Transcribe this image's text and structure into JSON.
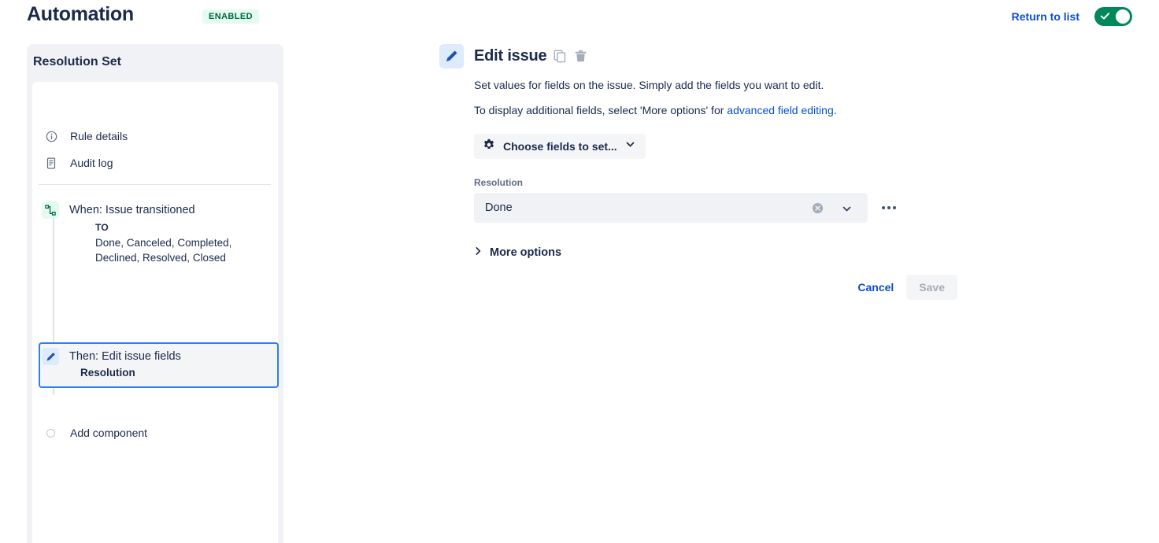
{
  "header": {
    "title": "Automation",
    "status_badge": "ENABLED",
    "return_link": "Return to list",
    "toggle_on": true,
    "toggle_color": "#00875A"
  },
  "sidebar": {
    "title": "Resolution Set",
    "nav_items": [
      {
        "label": "Rule details",
        "icon": "info-circle-icon"
      },
      {
        "label": "Audit log",
        "icon": "audit-log-icon"
      }
    ],
    "steps": [
      {
        "title": "When: Issue transitioned",
        "icon": "transition-icon",
        "detail_key": "TO",
        "detail_value": "Done, Canceled, Completed, Declined, Resolved, Closed",
        "selected": false
      },
      {
        "title": "Then: Edit issue fields",
        "icon": "pencil-icon",
        "subtitle": "Resolution",
        "selected": true
      }
    ],
    "add_component": "Add component"
  },
  "main": {
    "title": "Edit issue",
    "icon": "pencil-icon",
    "copy_icon": "copy-icon",
    "delete_icon": "trash-icon",
    "description_1": "Set values for fields on the issue. Simply add the fields you want to edit.",
    "description_2_before": "To display additional fields, select 'More options' for ",
    "description_2_link": "advanced field editing",
    "description_2_after": ".",
    "choose_fields_label": "Choose fields to set...",
    "field": {
      "label": "Resolution",
      "value": "Done"
    },
    "more_options_label": "More options",
    "cancel_label": "Cancel",
    "save_label": "Save"
  }
}
